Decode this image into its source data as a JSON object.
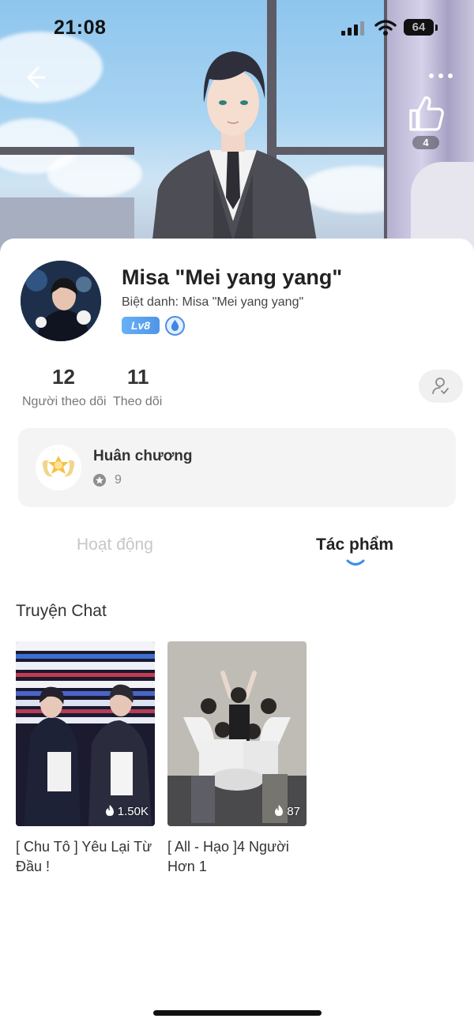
{
  "status_bar": {
    "time": "21:08",
    "battery": "64"
  },
  "header": {
    "like_count": "4"
  },
  "profile": {
    "name": "Misa \"Mei yang yang\"",
    "nickname": "Biệt danh: Misa \"Mei yang yang\"",
    "level": "Lv8"
  },
  "stats": {
    "followers": {
      "value": "12",
      "label": "Người theo dõi"
    },
    "following": {
      "value": "11",
      "label": "Theo dõi"
    }
  },
  "medals": {
    "title": "Huân chương",
    "count": "9"
  },
  "tabs": [
    {
      "label": "Hoạt động",
      "active": false
    },
    {
      "label": "Tác phẩm",
      "active": true
    }
  ],
  "section": {
    "title": "Truyện Chat"
  },
  "stories": [
    {
      "title": "[ Chu Tô ] Yêu Lại Từ Đầu !",
      "views": "1.50K"
    },
    {
      "title": "[ All - Hạo ]4 Người Hơn 1",
      "views": "87"
    }
  ],
  "colors": {
    "accent_blue": "#4f95e8",
    "tab_indicator": "#3d8fe8"
  }
}
